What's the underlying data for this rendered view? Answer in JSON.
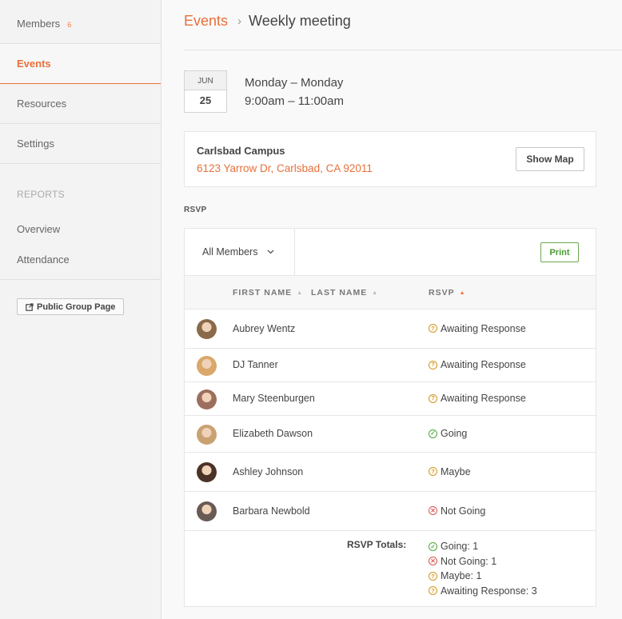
{
  "sidebar": {
    "members_label": "Members",
    "members_count": "6",
    "events_label": "Events",
    "resources_label": "Resources",
    "settings_label": "Settings",
    "reports_heading": "REPORTS",
    "overview_label": "Overview",
    "attendance_label": "Attendance",
    "public_page_label": "Public Group Page"
  },
  "breadcrumb": {
    "parent": "Events",
    "separator": "›",
    "current": "Weekly meeting"
  },
  "event": {
    "month": "JUN",
    "day": "25",
    "day_range": "Monday – Monday",
    "time_range": "9:00am – 11:00am"
  },
  "location": {
    "name": "Carlsbad Campus",
    "address": "6123 Yarrow Dr, Carlsbad, CA 92011",
    "show_map_label": "Show Map"
  },
  "rsvp": {
    "section_label": "RSVP",
    "filter_value": "All Members",
    "print_label": "Print",
    "columns": {
      "first_name": "FIRST NAME",
      "last_name": "LAST NAME",
      "rsvp": "RSVP"
    },
    "rows": [
      {
        "name": "Aubrey Wentz",
        "status": "Awaiting Response",
        "status_icon": "question-icon",
        "avatar_color": "#8a6a4a"
      },
      {
        "name": "DJ Tanner",
        "status": "Awaiting Response",
        "status_icon": "question-icon",
        "avatar_color": "#d9a86a"
      },
      {
        "name": "Mary Steenburgen",
        "status": "Awaiting Response",
        "status_icon": "question-icon",
        "avatar_color": "#9c6e5e"
      },
      {
        "name": "Elizabeth Dawson",
        "status": "Going",
        "status_icon": "check-icon",
        "avatar_color": "#c9a272"
      },
      {
        "name": "Ashley Johnson",
        "status": "Maybe",
        "status_icon": "question-icon",
        "avatar_color": "#4a3326"
      },
      {
        "name": "Barbara Newbold",
        "status": "Not Going",
        "status_icon": "x-icon",
        "avatar_color": "#6a5a55"
      }
    ],
    "totals_label": "RSVP Totals:",
    "totals": [
      {
        "text": "Going: 1",
        "icon": "check-icon"
      },
      {
        "text": "Not Going: 1",
        "icon": "x-icon"
      },
      {
        "text": "Maybe: 1",
        "icon": "question-icon"
      },
      {
        "text": "Awaiting Response: 3",
        "icon": "question-icon"
      }
    ]
  },
  "colors": {
    "accent": "#e8703a",
    "going": "#4fa53b",
    "not_going": "#d9534f",
    "pending": "#d4961c"
  }
}
